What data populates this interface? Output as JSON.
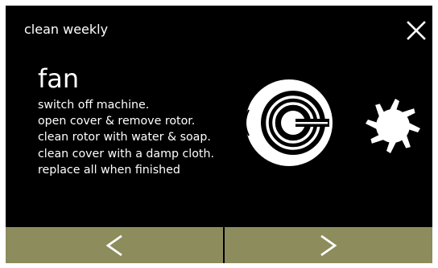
{
  "header": {
    "title": "clean weekly",
    "close_icon": "close-icon"
  },
  "step": {
    "title": "fan",
    "instructions": [
      "switch off machine.",
      "open cover & remove rotor.",
      "clean rotor with water & soap.",
      "clean cover with a damp cloth.",
      "replace all when finished"
    ]
  },
  "illustration": {
    "icons": [
      "fan-cover-icon",
      "fan-rotor-icon"
    ]
  },
  "nav": {
    "prev_icon": "chevron-left-icon",
    "next_icon": "chevron-right-icon"
  },
  "colors": {
    "background": "#000000",
    "text": "#ffffff",
    "nav_button": "#8c8c5c"
  }
}
